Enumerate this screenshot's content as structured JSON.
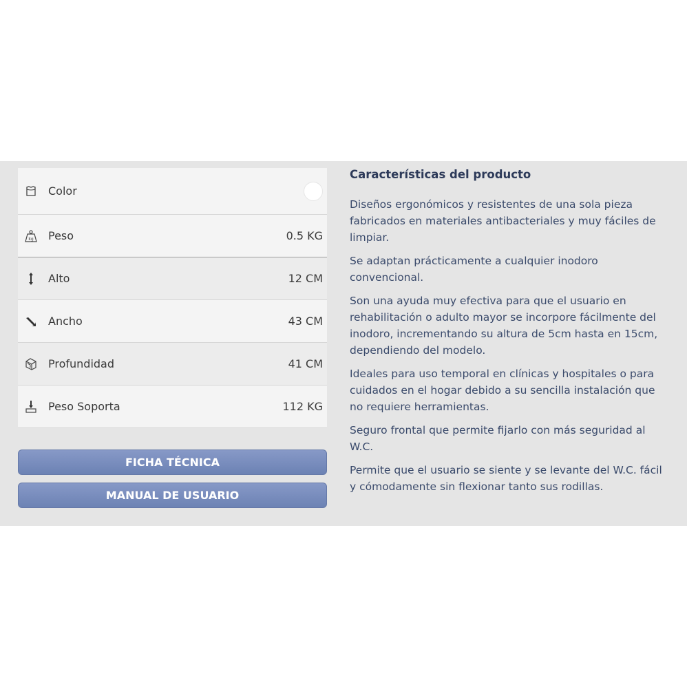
{
  "specs": {
    "color": {
      "label": "Color",
      "icon": "shirt-icon",
      "swatch": "#ffffff"
    },
    "peso": {
      "label": "Peso",
      "value": "0.5 KG",
      "icon": "weight-kg-icon",
      "icon_text": "kg"
    },
    "alto": {
      "label": "Alto",
      "value": "12 CM",
      "icon": "height-arrow-icon"
    },
    "ancho": {
      "label": "Ancho",
      "value": "43 CM",
      "icon": "width-arrow-icon"
    },
    "profundidad": {
      "label": "Profundidad",
      "value": "41 CM",
      "icon": "depth-box-icon"
    },
    "peso_soporta": {
      "label": "Peso Soporta",
      "value": "112 KG",
      "icon": "load-down-arrow-icon"
    }
  },
  "buttons": {
    "ficha": "FICHA TÉCNICA",
    "manual": "MANUAL DE USUARIO"
  },
  "description": {
    "title": "Características del producto",
    "paragraphs": [
      "Diseños ergonómicos y resistentes de una sola pieza fabricados en materiales antibacteriales y muy fáciles de limpiar.",
      "Se adaptan prácticamente a cualquier inodoro convencional.",
      "Son una ayuda muy efectiva para que el usuario en rehabilitación o adulto mayor se incorpore fácilmente del inodoro, incrementando su altura de 5cm hasta en 15cm, dependiendo del modelo.",
      "Ideales para uso temporal en clínicas y hospitales o para cuidados en el hogar debido a su sencilla instalación que no requiere herramientas.",
      "Seguro frontal que permite fijarlo con más seguridad al W.C.",
      "Permite que el usuario se siente y se levante del W.C. fácil y cómodamente sin flexionar tanto sus rodillas."
    ]
  },
  "colors": {
    "panel_bg": "#e5e5e5",
    "button_bg": "#7a8dbe",
    "title_text": "#2d3a59"
  }
}
